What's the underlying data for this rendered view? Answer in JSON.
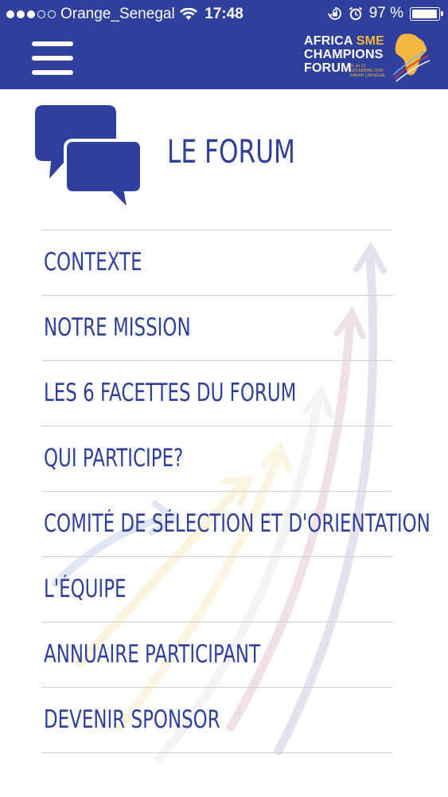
{
  "status_bar": {
    "carrier": "Orange_Senegal",
    "time": "17:48",
    "battery_percent": "97 %",
    "battery_level": 0.97,
    "signal_bars_filled": 3,
    "signal_bars_total": 5
  },
  "nav": {
    "menu_icon": "hamburger-icon",
    "logo": {
      "line1_a": "AFRICA",
      "line1_b": "SME",
      "line2": "CHAMPIONS",
      "line3": "FORUM",
      "date_line1": "11 au 12",
      "date_line2": "NOVEMBRE 2014",
      "date_line3": "DAKAR | SENEGAL"
    }
  },
  "section": {
    "icon": "chat-bubbles-icon",
    "title": "LE FORUM"
  },
  "menu": {
    "items": [
      {
        "label": "CONTEXTE"
      },
      {
        "label": "NOTRE MISSION"
      },
      {
        "label": "LES 6 FACETTES DU FORUM"
      },
      {
        "label": "QUI PARTICIPE?"
      },
      {
        "label": "COMITÉ DE SÉLECTION ET D'ORIENTATION"
      },
      {
        "label": "L'ÉQUIPE"
      },
      {
        "label": "ANNUAIRE PARTICIPANT"
      },
      {
        "label": "DEVENIR SPONSOR"
      }
    ]
  },
  "colors": {
    "brand_blue": "#2f3f9c",
    "accent_yellow": "#f4b740",
    "separator": "#cfcfcf"
  }
}
